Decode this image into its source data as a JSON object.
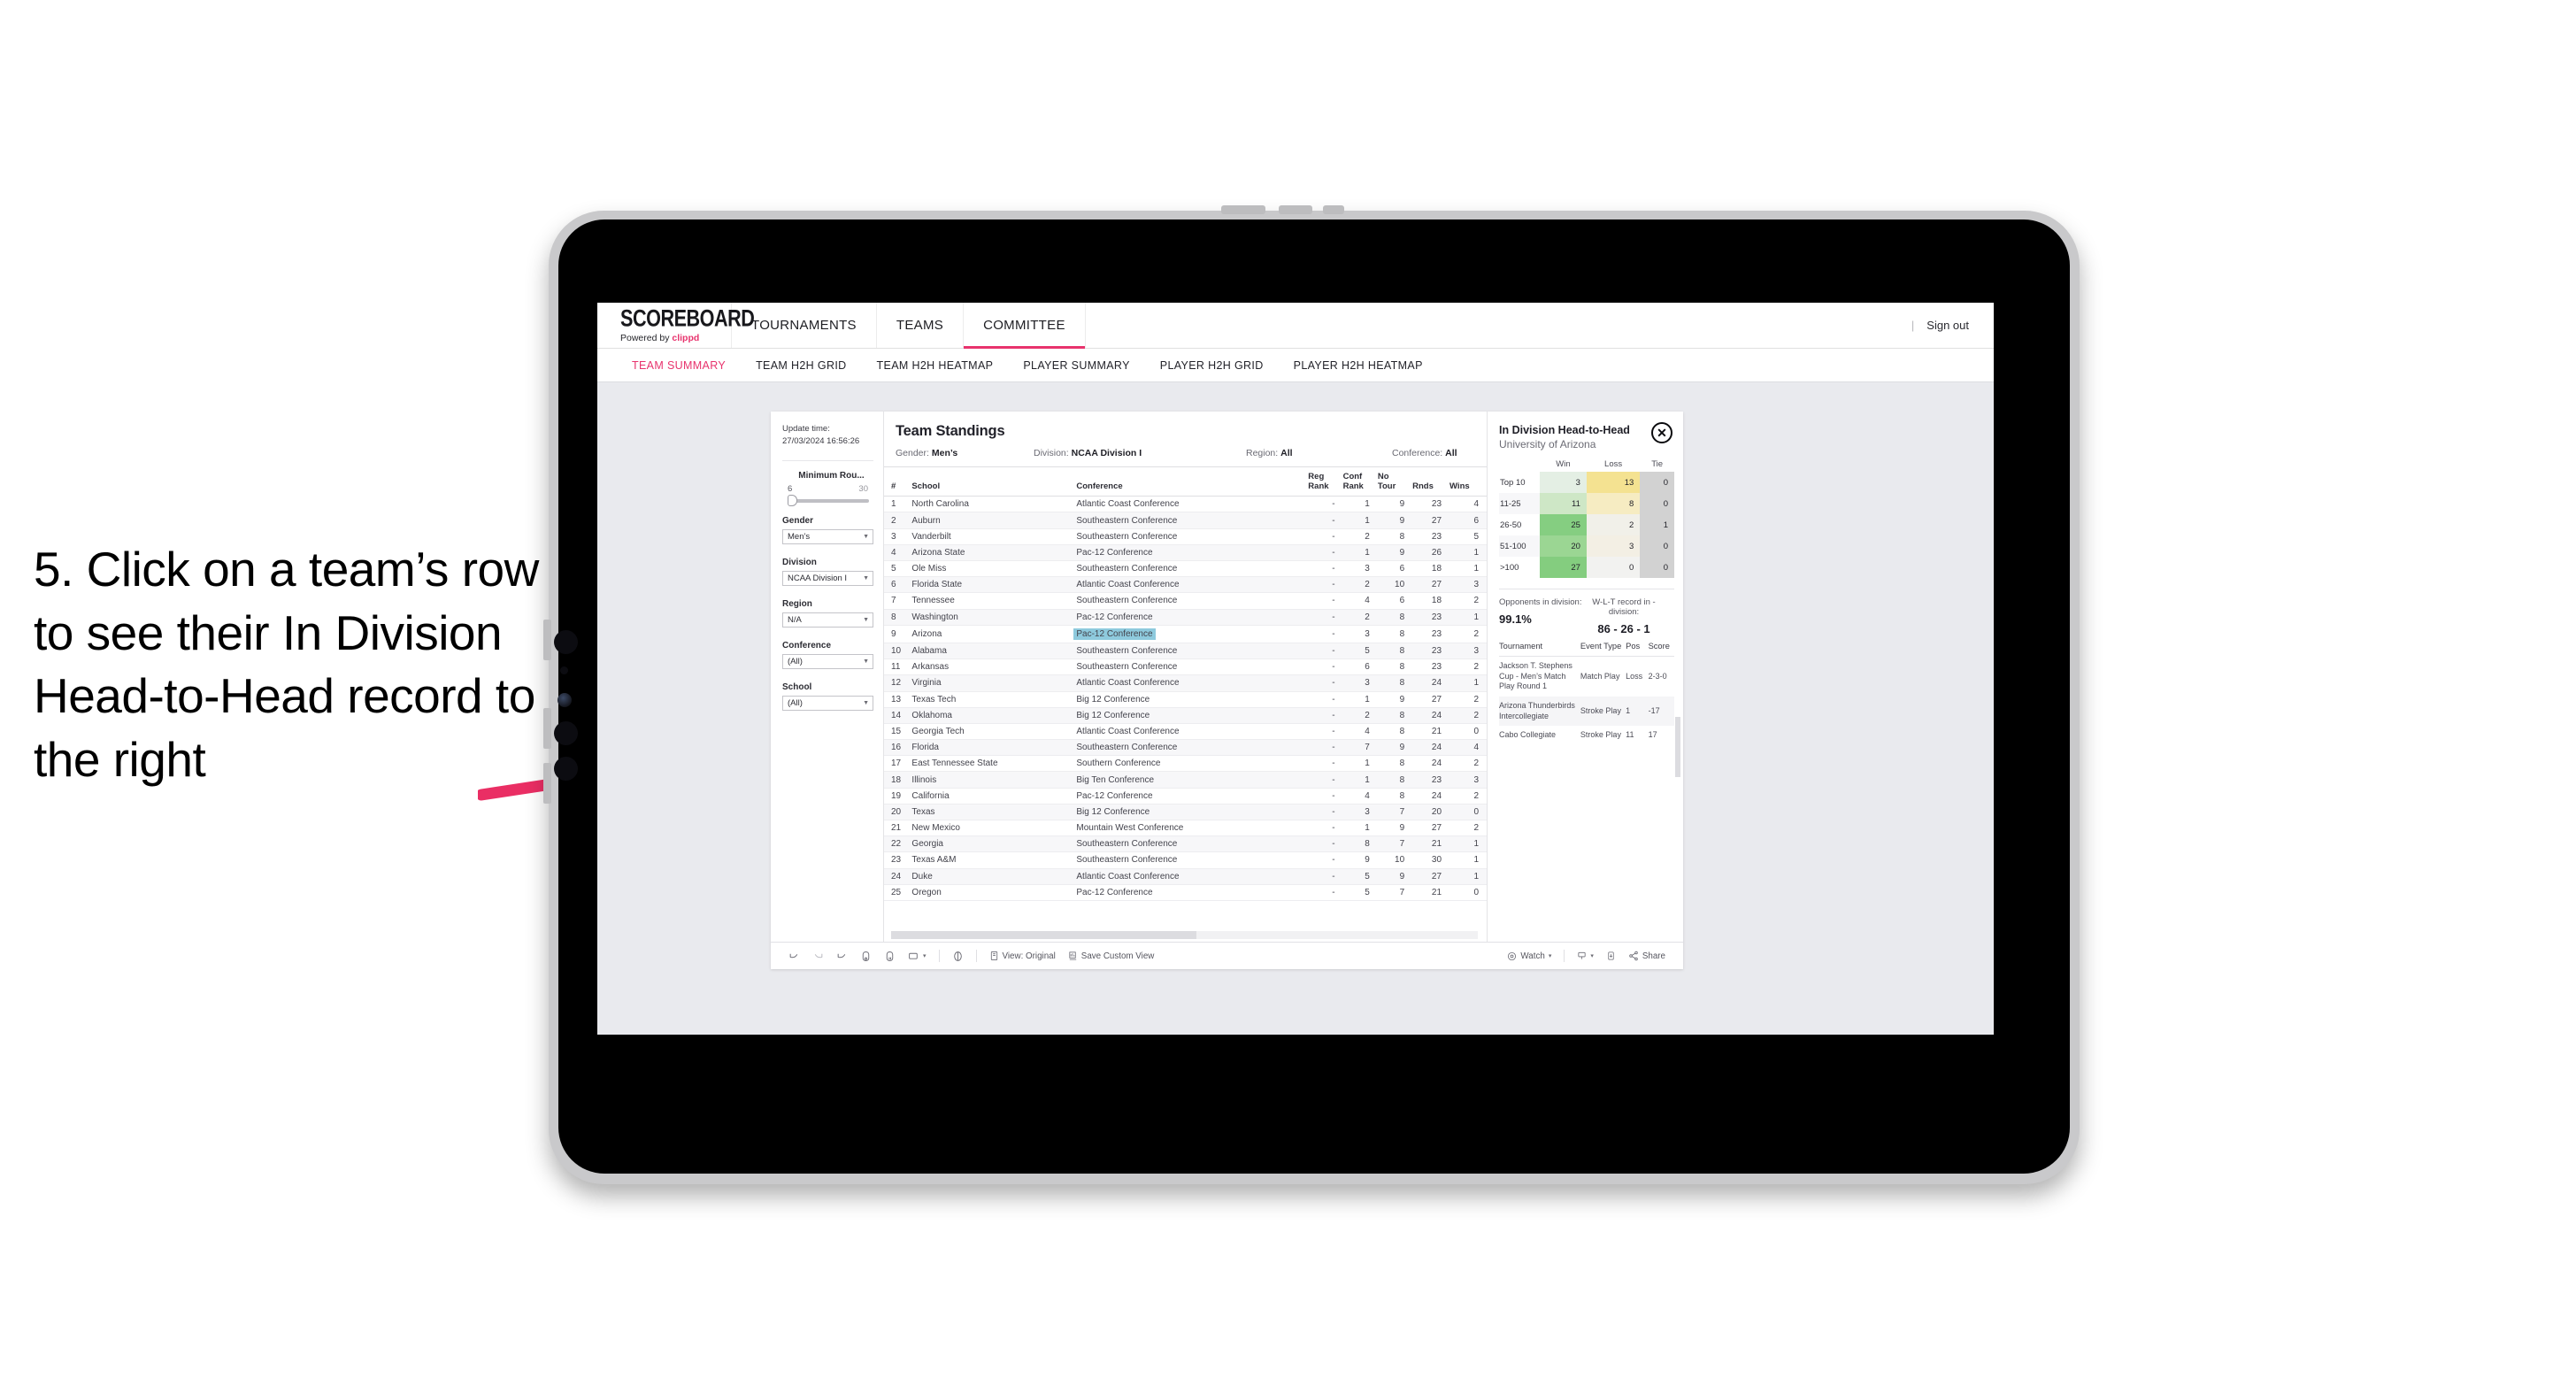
{
  "annotation": {
    "text": "5. Click on a team’s row to see their In Division Head-to-Head record to the right",
    "arrow_color": "#ea2e64"
  },
  "app": {
    "brand": {
      "title": "SCOREBOARD",
      "powered_prefix": "Powered by ",
      "powered_brand": "clippd"
    },
    "nav": [
      {
        "label": "TOURNAMENTS",
        "active": false
      },
      {
        "label": "TEAMS",
        "active": false
      },
      {
        "label": "COMMITTEE",
        "active": true
      }
    ],
    "sign_out": "Sign out",
    "sign_out_divider": "|",
    "subtabs": [
      {
        "label": "TEAM SUMMARY",
        "active": true
      },
      {
        "label": "TEAM H2H GRID",
        "active": false
      },
      {
        "label": "TEAM H2H HEATMAP",
        "active": false
      },
      {
        "label": "PLAYER SUMMARY",
        "active": false
      },
      {
        "label": "PLAYER H2H GRID",
        "active": false
      },
      {
        "label": "PLAYER H2H HEATMAP",
        "active": false
      }
    ]
  },
  "filters": {
    "update_label": "Update time:",
    "update_value": "27/03/2024 16:56:26",
    "slider": {
      "label": "Minimum Rou...",
      "min": "6",
      "max": "30",
      "value_pct": 4
    },
    "groups": [
      {
        "label": "Gender",
        "value": "Men’s"
      },
      {
        "label": "Division",
        "value": "NCAA Division I"
      },
      {
        "label": "Region",
        "value": "N/A"
      },
      {
        "label": "Conference",
        "value": "(All)"
      },
      {
        "label": "School",
        "value": "(All)"
      }
    ]
  },
  "standings": {
    "title": "Team Standings",
    "meta": [
      {
        "label": "Gender:",
        "value": "Men’s"
      },
      {
        "label": "Division:",
        "value": "NCAA Division I"
      },
      {
        "label": "Region:",
        "value": "All"
      },
      {
        "label": "Conference:",
        "value": "All"
      }
    ],
    "columns": [
      "#",
      "School",
      "Conference",
      "Reg Rank",
      "Conf Rank",
      "No Tour",
      "Rnds",
      "Wins"
    ],
    "selected_row": 9,
    "rows": [
      {
        "n": "1",
        "school": "North Carolina",
        "conf": "Atlantic Coast Conference",
        "reg": "-",
        "cr": "1",
        "nt": "9",
        "rnds": "23",
        "wins": "4"
      },
      {
        "n": "2",
        "school": "Auburn",
        "conf": "Southeastern Conference",
        "reg": "-",
        "cr": "1",
        "nt": "9",
        "rnds": "27",
        "wins": "6"
      },
      {
        "n": "3",
        "school": "Vanderbilt",
        "conf": "Southeastern Conference",
        "reg": "-",
        "cr": "2",
        "nt": "8",
        "rnds": "23",
        "wins": "5"
      },
      {
        "n": "4",
        "school": "Arizona State",
        "conf": "Pac-12 Conference",
        "reg": "-",
        "cr": "1",
        "nt": "9",
        "rnds": "26",
        "wins": "1"
      },
      {
        "n": "5",
        "school": "Ole Miss",
        "conf": "Southeastern Conference",
        "reg": "-",
        "cr": "3",
        "nt": "6",
        "rnds": "18",
        "wins": "1"
      },
      {
        "n": "6",
        "school": "Florida State",
        "conf": "Atlantic Coast Conference",
        "reg": "-",
        "cr": "2",
        "nt": "10",
        "rnds": "27",
        "wins": "3"
      },
      {
        "n": "7",
        "school": "Tennessee",
        "conf": "Southeastern Conference",
        "reg": "-",
        "cr": "4",
        "nt": "6",
        "rnds": "18",
        "wins": "2"
      },
      {
        "n": "8",
        "school": "Washington",
        "conf": "Pac-12 Conference",
        "reg": "-",
        "cr": "2",
        "nt": "8",
        "rnds": "23",
        "wins": "1"
      },
      {
        "n": "9",
        "school": "Arizona",
        "conf": "Pac-12 Conference",
        "reg": "-",
        "cr": "3",
        "nt": "8",
        "rnds": "23",
        "wins": "2"
      },
      {
        "n": "10",
        "school": "Alabama",
        "conf": "Southeastern Conference",
        "reg": "-",
        "cr": "5",
        "nt": "8",
        "rnds": "23",
        "wins": "3"
      },
      {
        "n": "11",
        "school": "Arkansas",
        "conf": "Southeastern Conference",
        "reg": "-",
        "cr": "6",
        "nt": "8",
        "rnds": "23",
        "wins": "2"
      },
      {
        "n": "12",
        "school": "Virginia",
        "conf": "Atlantic Coast Conference",
        "reg": "-",
        "cr": "3",
        "nt": "8",
        "rnds": "24",
        "wins": "1"
      },
      {
        "n": "13",
        "school": "Texas Tech",
        "conf": "Big 12 Conference",
        "reg": "-",
        "cr": "1",
        "nt": "9",
        "rnds": "27",
        "wins": "2"
      },
      {
        "n": "14",
        "school": "Oklahoma",
        "conf": "Big 12 Conference",
        "reg": "-",
        "cr": "2",
        "nt": "8",
        "rnds": "24",
        "wins": "2"
      },
      {
        "n": "15",
        "school": "Georgia Tech",
        "conf": "Atlantic Coast Conference",
        "reg": "-",
        "cr": "4",
        "nt": "8",
        "rnds": "21",
        "wins": "0"
      },
      {
        "n": "16",
        "school": "Florida",
        "conf": "Southeastern Conference",
        "reg": "-",
        "cr": "7",
        "nt": "9",
        "rnds": "24",
        "wins": "4"
      },
      {
        "n": "17",
        "school": "East Tennessee State",
        "conf": "Southern Conference",
        "reg": "-",
        "cr": "1",
        "nt": "8",
        "rnds": "24",
        "wins": "2"
      },
      {
        "n": "18",
        "school": "Illinois",
        "conf": "Big Ten Conference",
        "reg": "-",
        "cr": "1",
        "nt": "8",
        "rnds": "23",
        "wins": "3"
      },
      {
        "n": "19",
        "school": "California",
        "conf": "Pac-12 Conference",
        "reg": "-",
        "cr": "4",
        "nt": "8",
        "rnds": "24",
        "wins": "2"
      },
      {
        "n": "20",
        "school": "Texas",
        "conf": "Big 12 Conference",
        "reg": "-",
        "cr": "3",
        "nt": "7",
        "rnds": "20",
        "wins": "0"
      },
      {
        "n": "21",
        "school": "New Mexico",
        "conf": "Mountain West Conference",
        "reg": "-",
        "cr": "1",
        "nt": "9",
        "rnds": "27",
        "wins": "2"
      },
      {
        "n": "22",
        "school": "Georgia",
        "conf": "Southeastern Conference",
        "reg": "-",
        "cr": "8",
        "nt": "7",
        "rnds": "21",
        "wins": "1"
      },
      {
        "n": "23",
        "school": "Texas A&M",
        "conf": "Southeastern Conference",
        "reg": "-",
        "cr": "9",
        "nt": "10",
        "rnds": "30",
        "wins": "1"
      },
      {
        "n": "24",
        "school": "Duke",
        "conf": "Atlantic Coast Conference",
        "reg": "-",
        "cr": "5",
        "nt": "9",
        "rnds": "27",
        "wins": "1"
      },
      {
        "n": "25",
        "school": "Oregon",
        "conf": "Pac-12 Conference",
        "reg": "-",
        "cr": "5",
        "nt": "7",
        "rnds": "21",
        "wins": "0"
      }
    ]
  },
  "detail": {
    "title": "In Division Head-to-Head",
    "subtitle": "University of Arizona",
    "close_icon": "✕",
    "chart_data": {
      "type": "heatmap",
      "title": "In Division Head-to-Head",
      "subtitle": "University of Arizona",
      "columns": [
        "Win",
        "Loss",
        "Tie"
      ],
      "rows": [
        "Top 10",
        "11-25",
        "26-50",
        "51-100",
        ">100"
      ],
      "values": [
        [
          3,
          13,
          0
        ],
        [
          11,
          8,
          0
        ],
        [
          25,
          2,
          1
        ],
        [
          20,
          3,
          0
        ],
        [
          27,
          0,
          0
        ]
      ],
      "cell_colors": [
        [
          "#e4efe4",
          "#f4e291",
          "#d2d2d2"
        ],
        [
          "#cee7c6",
          "#f6ecc2",
          "#d2d2d2"
        ],
        [
          "#85ce81",
          "#f1f0e9",
          "#d2d2d2"
        ],
        [
          "#9bd693",
          "#f3efe4",
          "#d2d2d2"
        ],
        [
          "#84cd7f",
          "#f2f2f0",
          "#d2d2d2"
        ]
      ]
    },
    "stats": [
      {
        "label": "Opponents in division:",
        "value": "99.1%"
      },
      {
        "label": "W-L-T record in -division:",
        "value": "86 - 26 - 1"
      }
    ],
    "tournaments": {
      "columns": [
        "Tournament",
        "Event Type",
        "Pos",
        "Score"
      ],
      "rows": [
        {
          "name": "Jackson T. Stephens Cup - Men’s Match Play Round 1",
          "type": "Match Play",
          "pos": "Loss",
          "score": "2-3-0"
        },
        {
          "name": "Arizona Thunderbirds Intercollegiate",
          "type": "Stroke Play",
          "pos": "1",
          "score": "-17"
        },
        {
          "name": "Cabo Collegiate",
          "type": "Stroke Play",
          "pos": "11",
          "score": "17"
        }
      ]
    }
  },
  "toolbar": {
    "view_label": "View: Original",
    "save_label": "Save Custom View",
    "watch_label": "Watch",
    "share_label": "Share",
    "caret": "▾"
  }
}
